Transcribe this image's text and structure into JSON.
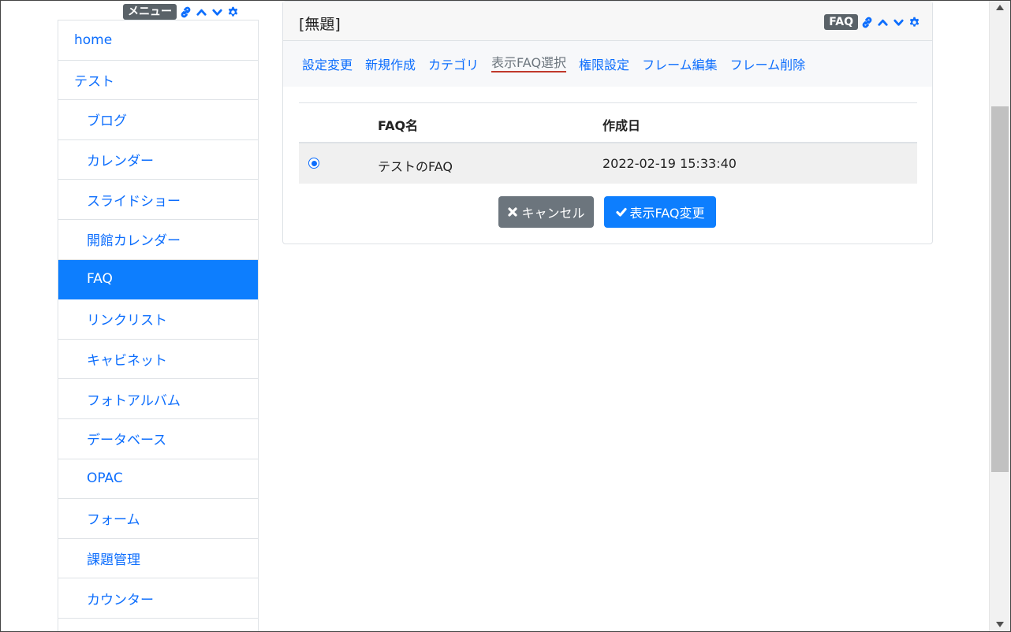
{
  "menu_frame": {
    "badge": "メニュー",
    "items": [
      {
        "label": "home",
        "level": 0,
        "active": false
      },
      {
        "label": "テスト",
        "level": 0,
        "active": false
      },
      {
        "label": "ブログ",
        "level": 1,
        "active": false
      },
      {
        "label": "カレンダー",
        "level": 1,
        "active": false
      },
      {
        "label": "スライドショー",
        "level": 1,
        "active": false
      },
      {
        "label": "開館カレンダー",
        "level": 1,
        "active": false
      },
      {
        "label": "FAQ",
        "level": 1,
        "active": true
      },
      {
        "label": "リンクリスト",
        "level": 1,
        "active": false
      },
      {
        "label": "キャビネット",
        "level": 1,
        "active": false
      },
      {
        "label": "フォトアルバム",
        "level": 1,
        "active": false
      },
      {
        "label": "データベース",
        "level": 1,
        "active": false
      },
      {
        "label": "OPAC",
        "level": 1,
        "active": false
      },
      {
        "label": "フォーム",
        "level": 1,
        "active": false
      },
      {
        "label": "課題管理",
        "level": 1,
        "active": false
      },
      {
        "label": "カウンター",
        "level": 1,
        "active": false
      },
      {
        "label": "",
        "level": 1,
        "active": false
      }
    ]
  },
  "main_frame": {
    "title": "[無題]",
    "badge": "FAQ",
    "tabs": [
      {
        "label": "設定変更",
        "active": false
      },
      {
        "label": "新規作成",
        "active": false
      },
      {
        "label": "カテゴリ",
        "active": false
      },
      {
        "label": "表示FAQ選択",
        "active": true
      },
      {
        "label": "権限設定",
        "active": false
      },
      {
        "label": "フレーム編集",
        "active": false
      },
      {
        "label": "フレーム削除",
        "active": false
      }
    ],
    "table": {
      "headers": {
        "name": "FAQ名",
        "created": "作成日"
      },
      "rows": [
        {
          "selected": true,
          "name": "テストのFAQ",
          "created": "2022-02-19 15:33:40"
        }
      ]
    },
    "buttons": {
      "cancel": "キャンセル",
      "submit": "表示FAQ変更"
    }
  },
  "colors": {
    "accent": "#0d6efd",
    "active_bg": "#0d7efe",
    "badge_bg": "#5a6268",
    "cancel_bg": "#6c757d"
  }
}
